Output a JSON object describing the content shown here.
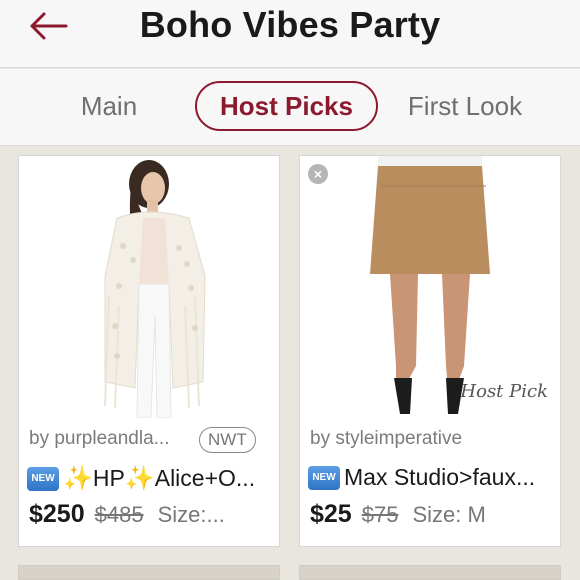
{
  "header": {
    "title": "Boho Vibes Party",
    "back_icon": "back-arrow-icon"
  },
  "tabs": [
    {
      "label": "Main",
      "active": false
    },
    {
      "label": "Host Picks",
      "active": true
    },
    {
      "label": "First Look",
      "active": false
    }
  ],
  "colors": {
    "accent": "#8b1a2e",
    "background": "#e9e6df",
    "muted_text": "#777777"
  },
  "listings": [
    {
      "seller": "by purpleandla...",
      "badge": "NWT",
      "new_label": "NEW",
      "title_sparkle_left": "✨",
      "title_text": "HP",
      "title_sparkle_right": "✨",
      "title_rest": "Alice+O...",
      "price": "$250",
      "original_price": "$485",
      "size": "Size:..."
    },
    {
      "seller": "by styleimperative",
      "new_label": "NEW",
      "title_text": "Max Studio>faux...",
      "price": "$25",
      "original_price": "$75",
      "size": "Size: M",
      "image_label": "Host Pick"
    }
  ]
}
